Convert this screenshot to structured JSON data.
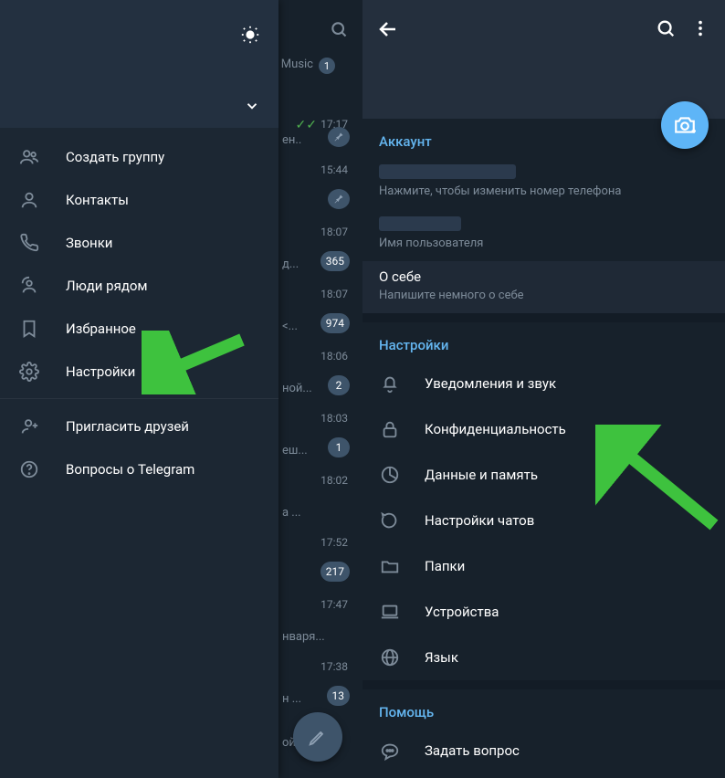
{
  "left": {
    "menu": [
      {
        "icon": "group",
        "label": "Создать группу"
      },
      {
        "icon": "person",
        "label": "Контакты"
      },
      {
        "icon": "phone",
        "label": "Звонки"
      },
      {
        "icon": "nearby",
        "label": "Люди рядом"
      },
      {
        "icon": "bookmark",
        "label": "Избранное"
      },
      {
        "icon": "gear",
        "label": "Настройки"
      }
    ],
    "menu2": [
      {
        "icon": "invite",
        "label": "Пригласить друзей"
      },
      {
        "icon": "help",
        "label": "Вопросы о Telegram"
      }
    ],
    "chats": [
      {
        "time": "",
        "music_label": "Music",
        "music_badge": "1"
      },
      {
        "time": "17:17",
        "checks": true,
        "frag": "ен..",
        "pin": true
      },
      {
        "time": "15:44",
        "pin": true
      },
      {
        "time": "18:07",
        "badge": "365",
        "frag": "д..."
      },
      {
        "time": "18:07",
        "badge": "974",
        "frag": "<..."
      },
      {
        "time": "18:06",
        "badge": "2",
        "frag": "ной..."
      },
      {
        "time": "18:03",
        "badge": "1",
        "frag": "еш..."
      },
      {
        "time": "18:02",
        "frag": "а ..."
      },
      {
        "time": "17:52",
        "badge": "217"
      },
      {
        "time": "17:47",
        "frag": "нваря..."
      },
      {
        "time": "17:38",
        "badge": "13",
        "frag": "н ..."
      },
      {
        "frag": "ой..."
      }
    ]
  },
  "right": {
    "account_header": "Аккаунт",
    "phone_sub": "Нажмите, чтобы изменить номер телефона",
    "username_sub": "Имя пользователя",
    "bio_title": "О себе",
    "bio_sub": "Напишите немного о себе",
    "settings_header": "Настройки",
    "settings": [
      {
        "icon": "bell",
        "label": "Уведомления и звук"
      },
      {
        "icon": "lock",
        "label": "Конфиденциальность"
      },
      {
        "icon": "pie",
        "label": "Данные и память"
      },
      {
        "icon": "chat",
        "label": "Настройки чатов"
      },
      {
        "icon": "folder",
        "label": "Папки"
      },
      {
        "icon": "laptop",
        "label": "Устройства"
      },
      {
        "icon": "globe",
        "label": "Язык"
      }
    ],
    "help_header": "Помощь",
    "help": [
      {
        "icon": "chat-q",
        "label": "Задать вопрос"
      }
    ]
  }
}
